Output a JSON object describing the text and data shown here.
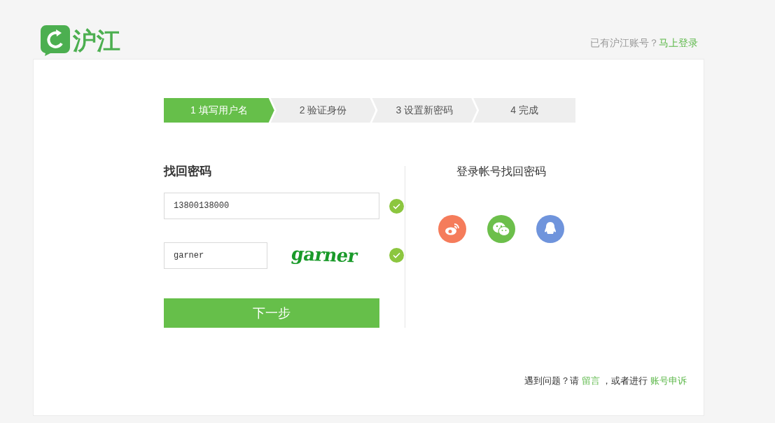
{
  "logo": {
    "text": "沪江"
  },
  "login_prompt": {
    "text": "已有沪江账号？",
    "link": "马上登录"
  },
  "steps": [
    {
      "label": "1 填写用户名",
      "selected": true
    },
    {
      "label": "2 验证身份",
      "selected": false
    },
    {
      "label": "3 设置新密码",
      "selected": false
    },
    {
      "label": "4 完成",
      "selected": false
    }
  ],
  "form": {
    "title": "找回密码",
    "phone": {
      "value": "13800138000",
      "valid": true
    },
    "captcha": {
      "value": "garner",
      "image_text": "garner",
      "valid": true
    },
    "submit": "下一步"
  },
  "social": {
    "title": "登录帐号找回密码",
    "items": [
      {
        "kind": "weibo",
        "color": "#f57c5b"
      },
      {
        "kind": "wechat",
        "color": "#6cbf4b"
      },
      {
        "kind": "qq",
        "color": "#6f94dc"
      }
    ]
  },
  "help": {
    "text": "遇到问题？请",
    "link1": "留言",
    "middle": "，或者进行",
    "link2": "账号申诉"
  }
}
